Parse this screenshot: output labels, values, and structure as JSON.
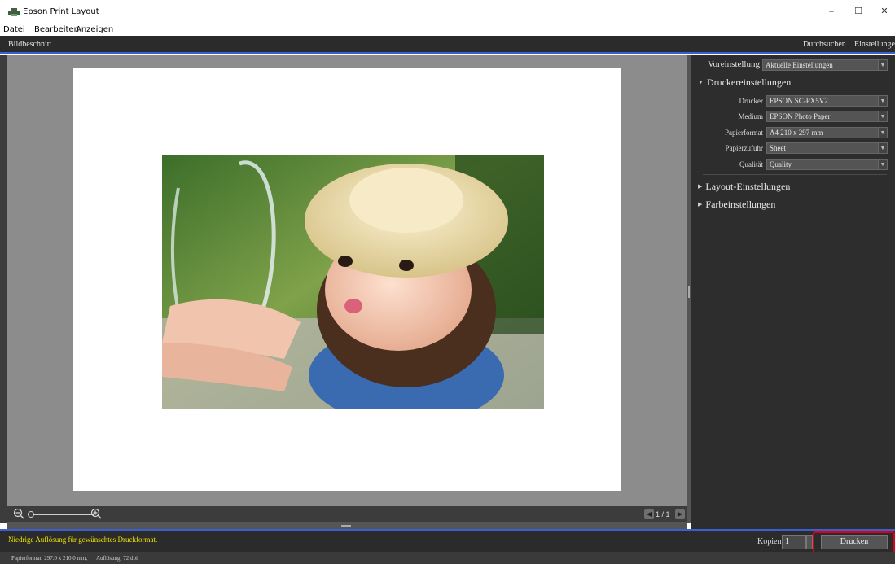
{
  "window": {
    "title": "Epson Print Layout"
  },
  "window_controls": {
    "minimize": "–",
    "maximize": "☐",
    "close": "✕"
  },
  "menu": [
    "Datei",
    "Bearbeiten",
    "Anzeigen"
  ],
  "toolbar": {
    "crop": "Bildbeschnitt",
    "browse": "Durchsuchen",
    "settings": "Einstellungen"
  },
  "preview": {
    "pager": {
      "prev_icon": "arrow-left-icon",
      "label": "1 / 1",
      "next_icon": "arrow-right-icon"
    },
    "zoom": {
      "out_icon": "zoom-out-icon",
      "in_icon": "zoom-in-icon",
      "level": 0
    }
  },
  "panel": {
    "preset": {
      "label": "Voreinstellung",
      "value": "Aktuelle Einstellungen"
    },
    "printer_section": "Druckereinstellungen",
    "printer_fields": [
      {
        "label": "Drucker",
        "value": "EPSON SC-PX5V2"
      },
      {
        "label": "Medium",
        "value": "EPSON Photo Paper"
      },
      {
        "label": "Papierformat",
        "value": "A4 210 x 297 mm"
      },
      {
        "label": "Papierzufuhr",
        "value": "Sheet"
      },
      {
        "label": "Qualität",
        "value": "Quality"
      }
    ],
    "layout_section": "Layout-Einstellungen",
    "color_section": "Farbeinstellungen"
  },
  "bottom": {
    "warning": "Niedrige Auflösung für gewünschtes Druckformat.",
    "copies_label": "Kopien",
    "copies_value": "1",
    "print_button": "Drucken"
  },
  "status": {
    "paper": "Papierformat: 297.0 x 210.0 mm,",
    "resolution": "Auflösung: 72 dpi"
  },
  "colors": {
    "accent": "#3b5fd1",
    "warning": "#f3e600",
    "highlight": "#d8001a"
  }
}
